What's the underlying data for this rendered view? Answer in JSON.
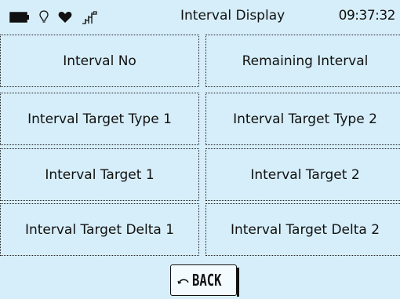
{
  "status": {
    "icons": [
      "battery-icon",
      "bulb-icon",
      "heart-icon",
      "signal-icon"
    ],
    "title": "Interval Display",
    "time": "09:37:32"
  },
  "cells": [
    "Interval No",
    "Remaining Interval",
    "Interval Target Type 1",
    "Interval Target Type 2",
    "Interval Target 1",
    "Interval Target 2",
    "Interval Target Delta 1",
    "Interval Target Delta 2"
  ],
  "back": {
    "label": "BACK"
  },
  "colors": {
    "background": "#d6eef9",
    "text": "#111111"
  }
}
